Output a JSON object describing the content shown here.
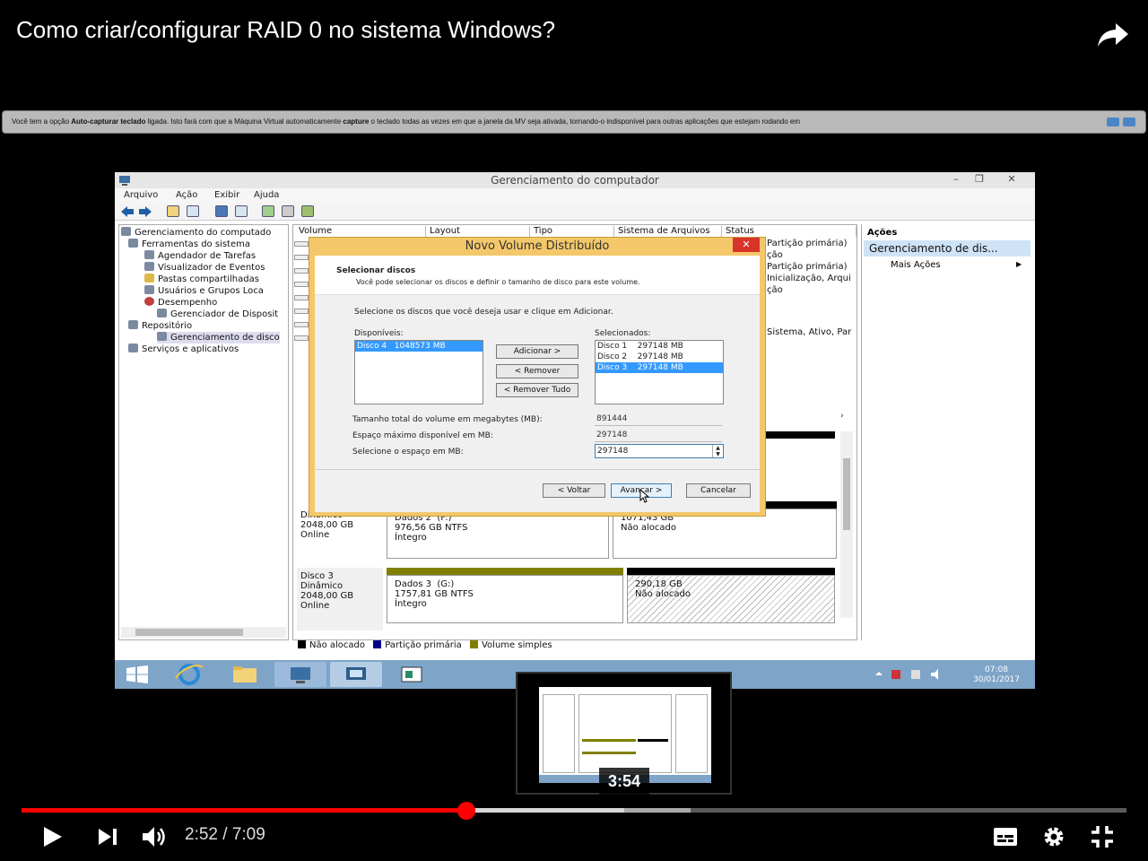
{
  "video": {
    "title": "Como criar/configurar RAID 0 no sistema Windows?",
    "current_time": "2:52",
    "separator": " / ",
    "duration": "7:09",
    "progress_played_fraction": 0.403,
    "progress_buffered_fraction": 0.605,
    "preview_time": "3:54"
  },
  "vm_notice": {
    "p1": "Você tem a opção ",
    "b1": "Auto-capturar teclado",
    "p2": " ligada. Isto fará com que a Máquina Virtual automaticamente ",
    "b2": "capture",
    "p3": " o teclado todas as vezes em que a janela da MV seja ativada, tornando-o indisponível para outras aplicações que estejam rodando em"
  },
  "window": {
    "title": "Gerenciamento do computador",
    "menu": [
      "Arquivo",
      "Ação",
      "Exibir",
      "Ajuda"
    ]
  },
  "tree": [
    "Gerenciamento do computado",
    "Ferramentas do sistema",
    "Agendador de Tarefas",
    "Visualizador de Eventos",
    "Pastas compartilhadas",
    "Usuários e Grupos Loca",
    "Desempenho",
    "Gerenciador de Disposit",
    "Repositório",
    "Gerenciamento de disco",
    "Serviços e aplicativos"
  ],
  "columns": [
    "Volume",
    "Layout",
    "Tipo",
    "Sistema de Arquivos",
    "Status"
  ],
  "status_fragments": [
    "Partição primária)",
    "ção",
    "Partição primária)",
    "Inicialização, Arqui",
    "ção",
    "Sistema, Ativo, Par"
  ],
  "disks": [
    {
      "label": "Dinâmico\n2048,00 GB\nOnline",
      "vol": "Dados 2  (F:)\n976,56 GB NTFS\nÍntegro",
      "free": "1071,43 GB\nNão alocado"
    },
    {
      "label": "Disco 3\nDinâmico\n2048,00 GB\nOnline",
      "vol": "Dados 3  (G:)\n1757,81 GB NTFS\nÍntegro",
      "free": "290,18 GB\nNão alocado"
    }
  ],
  "legend": [
    "Não alocado",
    "Partição primária",
    "Volume simples"
  ],
  "legend_colors": [
    "#000000",
    "#00008b",
    "#808000"
  ],
  "actions": {
    "header": "Ações",
    "selected": "Gerenciamento de dis...",
    "more": "Mais Ações"
  },
  "dialog": {
    "title": "Novo Volume Distribuído",
    "heading": "Selecionar discos",
    "subheading": "Você pode selecionar os discos e definir o tamanho de disco para este volume.",
    "instruction": "Selecione os discos que você deseja usar e clique em Adicionar.",
    "available_label": "Disponíveis:",
    "available": [
      {
        "disk": "Disco 4",
        "size": "1048573 MB"
      }
    ],
    "selected_label": "Selecionados:",
    "selected": [
      {
        "disk": "Disco 1",
        "size": "297148 MB"
      },
      {
        "disk": "Disco 2",
        "size": "297148 MB"
      },
      {
        "disk": "Disco 3",
        "size": "297148 MB"
      }
    ],
    "add": "Adicionar >",
    "remove": "< Remover",
    "remove_all": "< Remover Tudo",
    "total_label": "Tamanho total do volume em megabytes (MB):",
    "total_value": "891444",
    "max_label": "Espaço máximo disponível em MB:",
    "max_value": "297148",
    "select_label": "Selecione o espaço em MB:",
    "select_value": "297148",
    "back": "< Voltar",
    "next": "Avançar >",
    "cancel": "Cancelar"
  },
  "clock": {
    "time": "07:08",
    "date": "30/01/2017"
  }
}
